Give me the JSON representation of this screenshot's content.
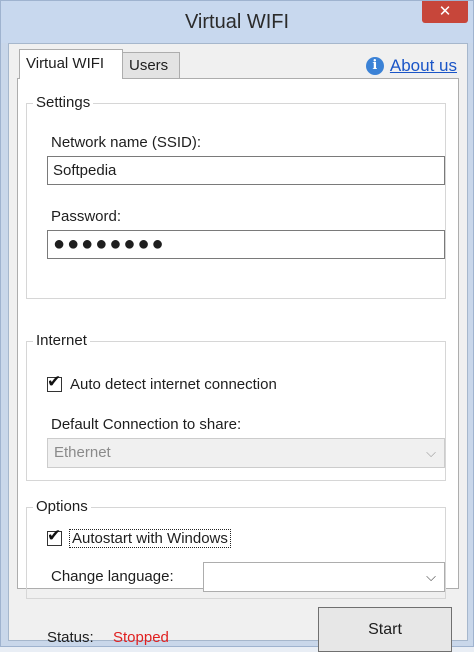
{
  "window": {
    "title": "Virtual WIFI",
    "close_glyph": "✕"
  },
  "tabs": [
    {
      "label": "Virtual WIFI",
      "active": true
    },
    {
      "label": "Users",
      "active": false
    }
  ],
  "about": {
    "icon": "info-icon",
    "label": "About us",
    "icon_glyph": "i"
  },
  "settings": {
    "legend": "Settings",
    "ssid_label": "Network name (SSID):",
    "ssid_value": "Softpedia",
    "password_label": "Password:",
    "password_value": "●●●●●●●●"
  },
  "internet": {
    "legend": "Internet",
    "auto_detect_label": "Auto detect internet connection",
    "auto_detect_checked": true,
    "default_connection_label": "Default Connection to share:",
    "default_connection_value": "Ethernet"
  },
  "options": {
    "legend": "Options",
    "autostart_label": "Autostart with Windows",
    "autostart_checked": true,
    "language_label": "Change language:",
    "language_value": ""
  },
  "status": {
    "label": "Status:",
    "value": "Stopped",
    "value_color": "#e02020"
  },
  "actions": {
    "start_label": "Start"
  },
  "glyphs": {
    "check": "✔",
    "chevron": "⌵"
  }
}
